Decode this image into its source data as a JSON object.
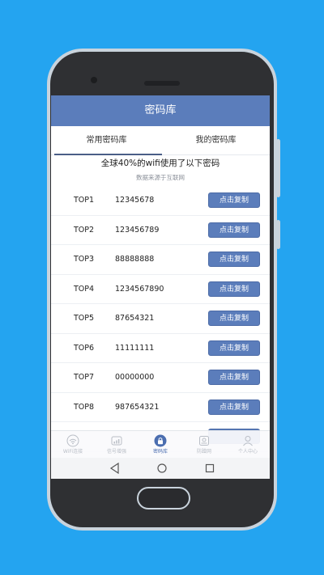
{
  "app": {
    "title": "密码库"
  },
  "tabs": [
    {
      "label": "常用密码库",
      "active": true
    },
    {
      "label": "我的密码库",
      "active": false
    }
  ],
  "headline": "全球40%的wifi使用了以下密码",
  "source_note": "数据来源于互联网",
  "copy_label": "点击复制",
  "passwords": [
    {
      "rank": "TOP1",
      "value": "12345678"
    },
    {
      "rank": "TOP2",
      "value": "123456789"
    },
    {
      "rank": "TOP3",
      "value": "88888888"
    },
    {
      "rank": "TOP4",
      "value": "1234567890"
    },
    {
      "rank": "TOP5",
      "value": "87654321"
    },
    {
      "rank": "TOP6",
      "value": "11111111"
    },
    {
      "rank": "TOP7",
      "value": "00000000"
    },
    {
      "rank": "TOP8",
      "value": "987654321"
    }
  ],
  "bottom_tabs": [
    {
      "label": "WiFi连接",
      "icon": "wifi-icon",
      "active": false
    },
    {
      "label": "信号增强",
      "icon": "signal-icon",
      "active": false
    },
    {
      "label": "密码库",
      "icon": "lock-icon",
      "active": true
    },
    {
      "label": "防蹭网",
      "icon": "router-icon",
      "active": false
    },
    {
      "label": "个人中心",
      "icon": "person-icon",
      "active": false
    }
  ],
  "colors": {
    "primary": "#5b7dbb",
    "background": "#24a4f0",
    "phone_body": "#2f3033"
  }
}
